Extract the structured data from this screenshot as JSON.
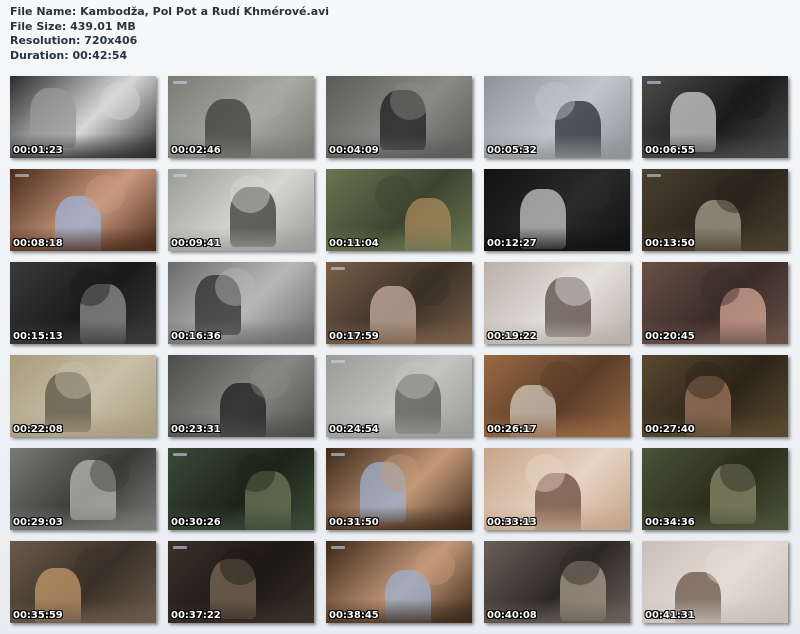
{
  "info": {
    "file_name": "File Name: Kambodža, Pol Pot a Rudí Khmérové.avi",
    "file_size": "File Size: 439.01 MB",
    "resolution": "Resolution: 720x406",
    "duration": "Duration: 00:42:54"
  },
  "thumbnails": [
    {
      "time": "00:01:23",
      "colors": [
        "#2b2b2b",
        "#9a9a9a",
        "#d8d8d8"
      ]
    },
    {
      "time": "00:02:46",
      "colors": [
        "#7a7a74",
        "#3e3e3a",
        "#a9a9a3"
      ]
    },
    {
      "time": "00:04:09",
      "colors": [
        "#5a5a58",
        "#1e1e1e",
        "#8a8a88"
      ]
    },
    {
      "time": "00:05:32",
      "colors": [
        "#8e9196",
        "#2a2c30",
        "#c2c5ca"
      ]
    },
    {
      "time": "00:06:55",
      "colors": [
        "#4c4c4c",
        "#d0d0d0",
        "#1a1a1a"
      ]
    },
    {
      "time": "00:08:18",
      "colors": [
        "#4a2a1a",
        "#9fb3d8",
        "#c99a7e"
      ]
    },
    {
      "time": "00:09:41",
      "colors": [
        "#9a9a96",
        "#3a3a38",
        "#d6d6d2"
      ]
    },
    {
      "time": "00:11:04",
      "colors": [
        "#6b7550",
        "#a88a5c",
        "#3c4430"
      ]
    },
    {
      "time": "00:12:27",
      "colors": [
        "#111111",
        "#c8c8c8",
        "#2a2a2a"
      ]
    },
    {
      "time": "00:13:50",
      "colors": [
        "#4a4030",
        "#a8a090",
        "#2a241c"
      ]
    },
    {
      "time": "00:15:13",
      "colors": [
        "#3a3a3a",
        "#909090",
        "#1a1a1a"
      ]
    },
    {
      "time": "00:16:36",
      "colors": [
        "#6a6a6a",
        "#2c2c2c",
        "#b8b8b8"
      ]
    },
    {
      "time": "00:17:59",
      "colors": [
        "#7a6048",
        "#c8b0a0",
        "#3a3028"
      ]
    },
    {
      "time": "00:19:22",
      "colors": [
        "#b8b0a8",
        "#5a4c44",
        "#e4e0dc"
      ]
    },
    {
      "time": "00:20:45",
      "colors": [
        "#6a5048",
        "#d8a898",
        "#3a2c28"
      ]
    },
    {
      "time": "00:22:08",
      "colors": [
        "#a89a7c",
        "#5c5444",
        "#c8c0a8"
      ]
    },
    {
      "time": "00:23:31",
      "colors": [
        "#4c4c4a",
        "#1c1c1c",
        "#888886"
      ]
    },
    {
      "time": "00:24:54",
      "colors": [
        "#9a9a98",
        "#5a5a58",
        "#c4c4c2"
      ]
    },
    {
      "time": "00:26:17",
      "colors": [
        "#9a6a44",
        "#d0c8bc",
        "#5a3c28"
      ]
    },
    {
      "time": "00:27:40",
      "colors": [
        "#5a4a30",
        "#a07860",
        "#2c2418"
      ]
    },
    {
      "time": "00:29:03",
      "colors": [
        "#7a7a78",
        "#b8b8b6",
        "#3a3a38"
      ]
    },
    {
      "time": "00:30:26",
      "colors": [
        "#3c4a38",
        "#6c7a58",
        "#1c2418"
      ]
    },
    {
      "time": "00:31:50",
      "colors": [
        "#3a2818",
        "#9cb0d0",
        "#c49878"
      ]
    },
    {
      "time": "00:33:13",
      "colors": [
        "#c4a488",
        "#6a4a3a",
        "#e8d4c4"
      ]
    },
    {
      "time": "00:34:36",
      "colors": [
        "#4c5438",
        "#8a8a6a",
        "#2a2c1c"
      ]
    },
    {
      "time": "00:35:59",
      "colors": [
        "#6a5a4a",
        "#c49a6a",
        "#3a3028"
      ]
    },
    {
      "time": "00:37:22",
      "colors": [
        "#3a3028",
        "#7a6a58",
        "#1c1814"
      ]
    },
    {
      "time": "00:38:45",
      "colors": [
        "#3a2818",
        "#9cb0d0",
        "#c49878"
      ]
    },
    {
      "time": "00:40:08",
      "colors": [
        "#6a6058",
        "#a89c8c",
        "#2c2824"
      ]
    },
    {
      "time": "00:41:31",
      "colors": [
        "#c8c0b8",
        "#6a5448",
        "#e4dcd4"
      ]
    }
  ]
}
